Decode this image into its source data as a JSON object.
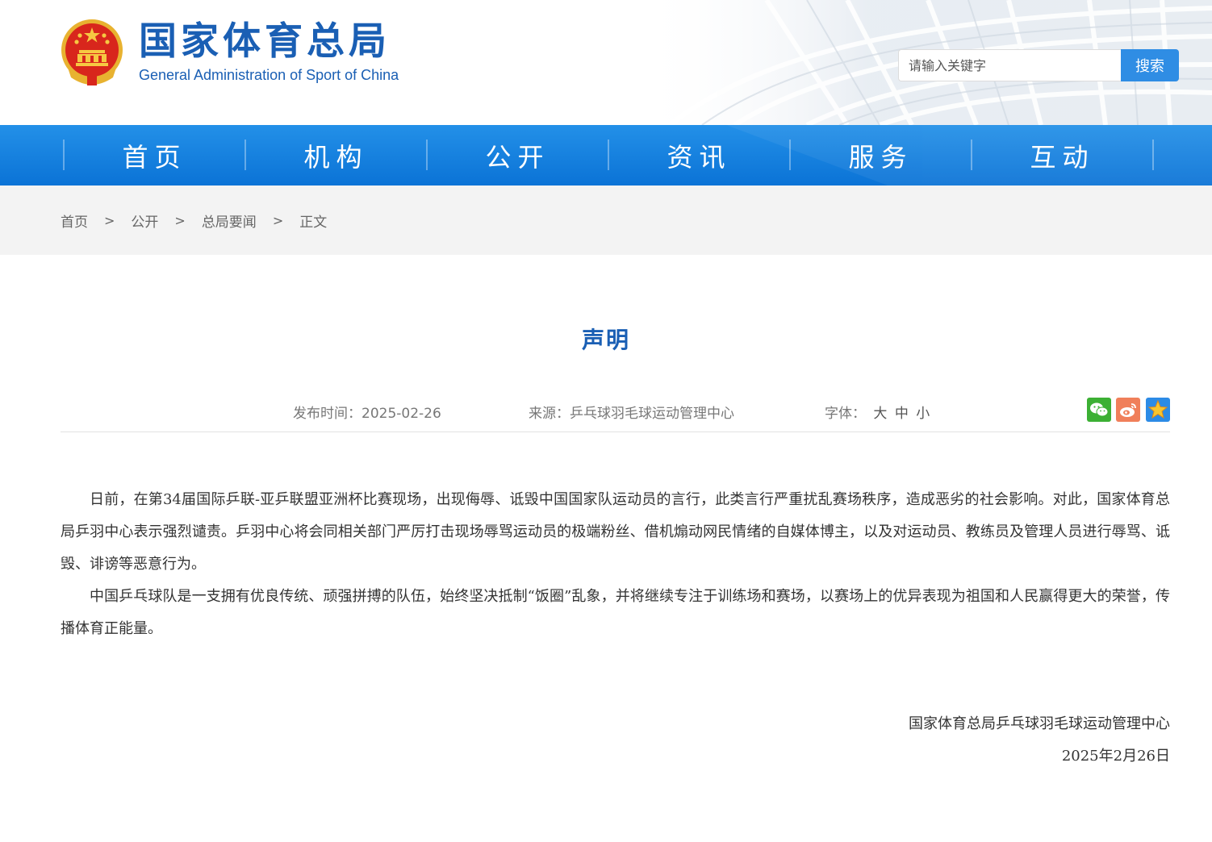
{
  "header": {
    "logo_cn": "国家体育总局",
    "logo_en": "General Administration of Sport of China",
    "search_placeholder": "请输入关键字",
    "search_button": "搜索"
  },
  "nav": {
    "items": [
      {
        "label": "首页"
      },
      {
        "label": "机构"
      },
      {
        "label": "公开"
      },
      {
        "label": "资讯"
      },
      {
        "label": "服务"
      },
      {
        "label": "互动"
      }
    ]
  },
  "breadcrumb": {
    "items": [
      "首页",
      "公开",
      "总局要闻",
      "正文"
    ],
    "separator": ">"
  },
  "article": {
    "title": "声明",
    "date_label": "发布时间：2025-02-26",
    "source_label": "来源：乒乓球羽毛球运动管理中心",
    "font_label": "字体：",
    "font_large": "大",
    "font_medium": "中",
    "font_small": "小",
    "paragraphs": [
      "日前，在第34届国际乒联-亚乒联盟亚洲杯比赛现场，出现侮辱、诋毁中国国家队运动员的言行，此类言行严重扰乱赛场秩序，造成恶劣的社会影响。对此，国家体育总局乒羽中心表示强烈谴责。乒羽中心将会同相关部门严厉打击现场辱骂运动员的极端粉丝、借机煽动网民情绪的自媒体博主，以及对运动员、教练员及管理人员进行辱骂、诋毁、诽谤等恶意行为。",
      "中国乒乓球队是一支拥有优良传统、顽强拼搏的队伍，始终坚决抵制“饭圈”乱象，并将继续专注于训练场和赛场，以赛场上的优异表现为祖国和人民赢得更大的荣誉，传播体育正能量。"
    ],
    "signature_org": "国家体育总局乒乓球羽毛球运动管理中心",
    "signature_date": "2025年2月26日"
  },
  "share": {
    "icons": [
      "wechat-icon",
      "weibo-icon",
      "favorite-star-icon"
    ]
  },
  "colors": {
    "brand_blue": "#1a5fb4",
    "nav_blue": "#0b73d6",
    "search_button": "#2f8de4",
    "wechat_green": "#3cb034",
    "weibo_orange": "#f07f5a"
  }
}
